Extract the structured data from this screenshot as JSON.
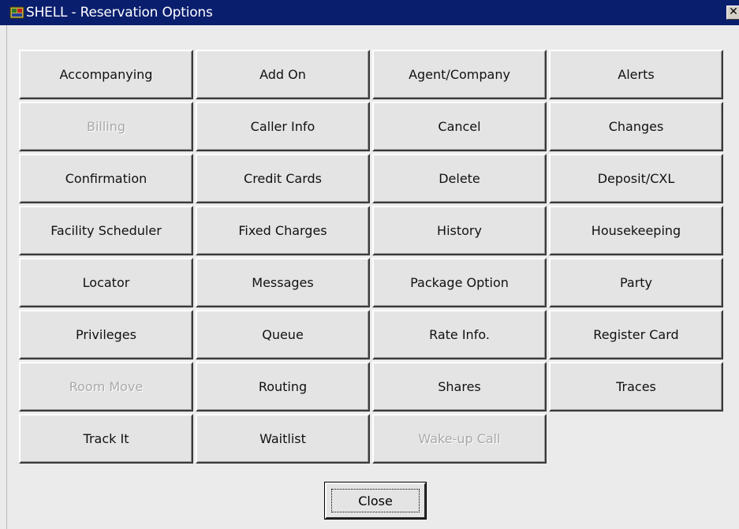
{
  "window": {
    "title": "SHELL - Reservation Options",
    "close_glyph": "✕",
    "icon": "app-icon"
  },
  "buttons": [
    {
      "label": "Accompanying",
      "enabled": true
    },
    {
      "label": "Add On",
      "enabled": true
    },
    {
      "label": "Agent/Company",
      "enabled": true
    },
    {
      "label": "Alerts",
      "enabled": true
    },
    {
      "label": "Billing",
      "enabled": false
    },
    {
      "label": "Caller Info",
      "enabled": true
    },
    {
      "label": "Cancel",
      "enabled": true
    },
    {
      "label": "Changes",
      "enabled": true
    },
    {
      "label": "Confirmation",
      "enabled": true
    },
    {
      "label": "Credit Cards",
      "enabled": true
    },
    {
      "label": "Delete",
      "enabled": true
    },
    {
      "label": "Deposit/CXL",
      "enabled": true
    },
    {
      "label": "Facility Scheduler",
      "enabled": true
    },
    {
      "label": "Fixed Charges",
      "enabled": true
    },
    {
      "label": "History",
      "enabled": true
    },
    {
      "label": "Housekeeping",
      "enabled": true
    },
    {
      "label": "Locator",
      "enabled": true
    },
    {
      "label": "Messages",
      "enabled": true
    },
    {
      "label": "Package Option",
      "enabled": true
    },
    {
      "label": "Party",
      "enabled": true
    },
    {
      "label": "Privileges",
      "enabled": true
    },
    {
      "label": "Queue",
      "enabled": true
    },
    {
      "label": "Rate Info.",
      "enabled": true
    },
    {
      "label": "Register Card",
      "enabled": true
    },
    {
      "label": "Room Move",
      "enabled": false
    },
    {
      "label": "Routing",
      "enabled": true
    },
    {
      "label": "Shares",
      "enabled": true
    },
    {
      "label": "Traces",
      "enabled": true
    },
    {
      "label": "Track It",
      "enabled": true
    },
    {
      "label": "Waitlist",
      "enabled": true
    },
    {
      "label": "Wake-up Call",
      "enabled": false
    }
  ],
  "footer": {
    "close_label": "Close"
  },
  "colors": {
    "titlebar": "#0a1e6e",
    "background": "#ebebeb",
    "button_face": "#e4e4e4",
    "disabled_text": "#a9a9a9"
  }
}
